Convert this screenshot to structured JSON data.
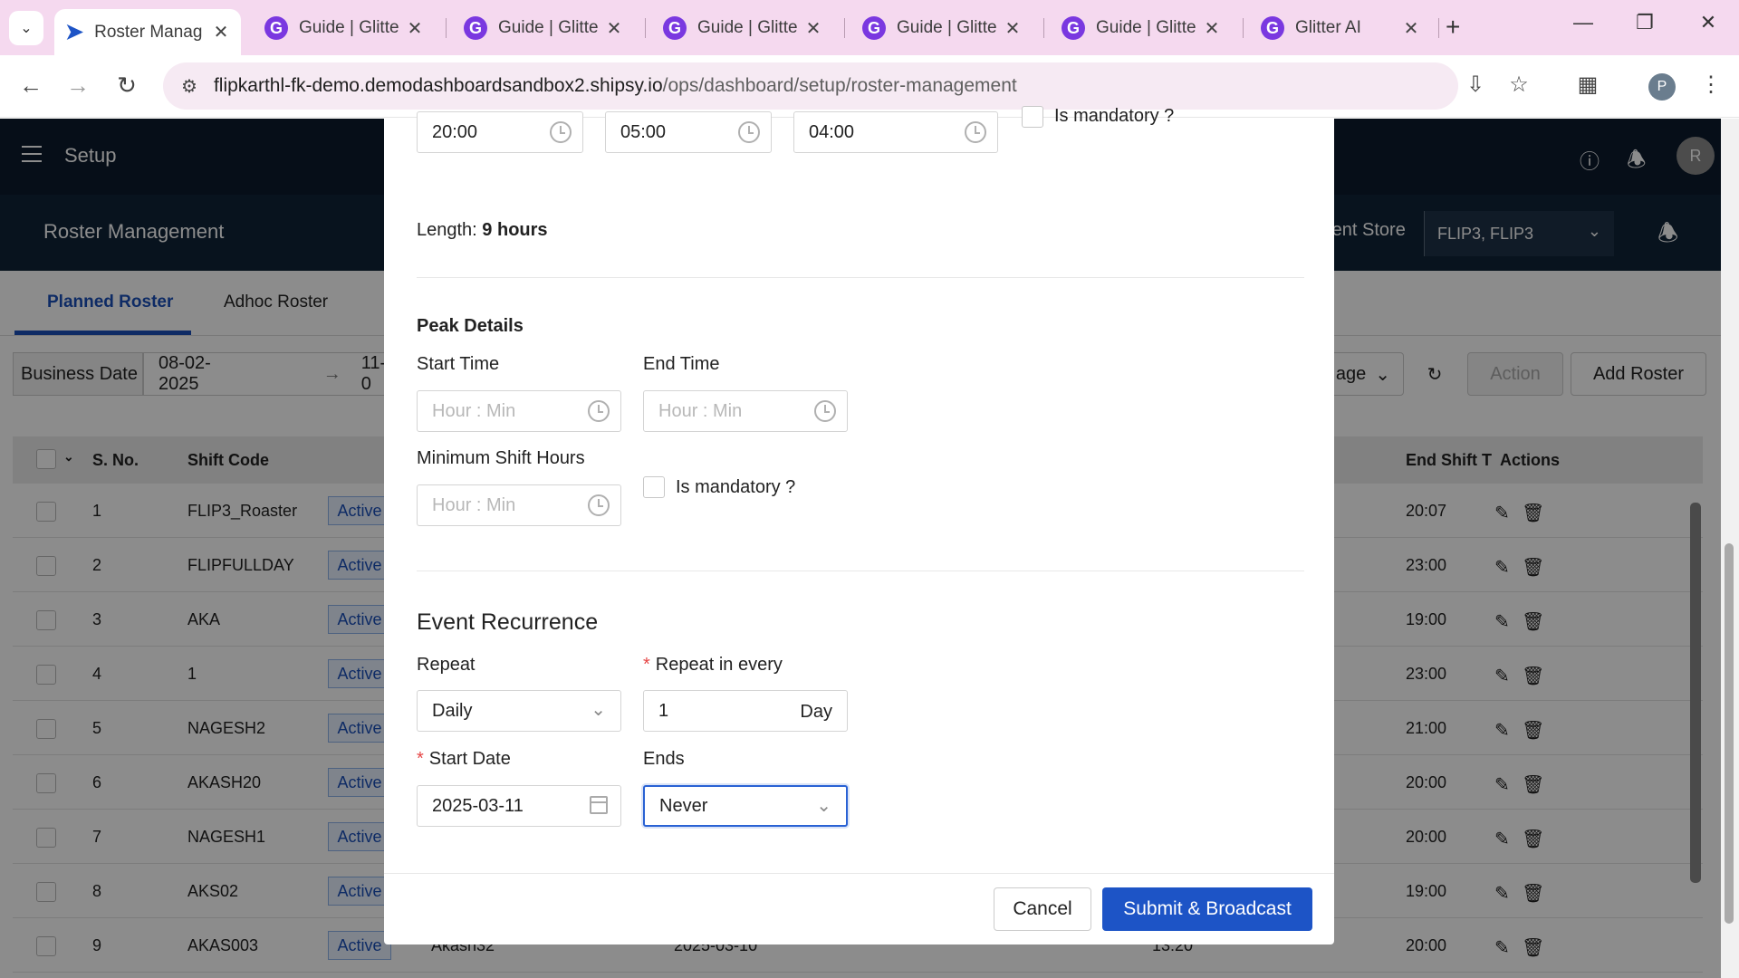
{
  "browser": {
    "tabs": [
      {
        "title": "Roster Manag",
        "active": true,
        "icon": "shipsy-icon"
      },
      {
        "title": "Guide | Glitter",
        "icon": "glitter-icon"
      },
      {
        "title": "Guide | Glitter",
        "icon": "glitter-icon"
      },
      {
        "title": "Guide | Glitter",
        "icon": "glitter-icon"
      },
      {
        "title": "Guide | Glitter",
        "icon": "glitter-icon"
      },
      {
        "title": "Guide | Glitter",
        "icon": "glitter-icon"
      },
      {
        "title": "Glitter AI",
        "icon": "glitter-icon"
      }
    ],
    "url_host": "flipkarthl-fk-demo.demodashboardsandbox2.shipsy.io",
    "url_path": "/ops/dashboard/setup/roster-management",
    "profile_initial": "P",
    "colors": {
      "tabbar": "#f5d9ef",
      "accent": "#1d54c6"
    }
  },
  "app": {
    "header_title": "Setup",
    "avatar_initial": "R",
    "sub_title": "Roster Management",
    "store_label": "rent Store",
    "store_value": "FLIP3, FLIP3",
    "tabs": [
      "Planned Roster",
      "Adhoc Roster"
    ],
    "filter": {
      "business_date_label": "Business Date",
      "start_date": "08-02-2025",
      "end_date_partial": "11-0",
      "page_partial": "age",
      "action_label": "Action",
      "add_roster_label": "Add Roster"
    },
    "table": {
      "headers": {
        "sno": "S. No.",
        "shift_code": "Shift Code",
        "end_shift": "End Shift T",
        "actions": "Actions"
      },
      "rows": [
        {
          "sno": "1",
          "code": "FLIP3_Roaster",
          "status": "Active",
          "end": "20:07"
        },
        {
          "sno": "2",
          "code": "FLIPFULLDAY",
          "status": "Active",
          "end": "23:00"
        },
        {
          "sno": "3",
          "code": "AKA",
          "status": "Active",
          "end": "19:00"
        },
        {
          "sno": "4",
          "code": "1",
          "status": "Active",
          "end": "23:00"
        },
        {
          "sno": "5",
          "code": "NAGESH2",
          "status": "Active",
          "end": "21:00"
        },
        {
          "sno": "6",
          "code": "AKASH20",
          "status": "Active",
          "end": "20:00"
        },
        {
          "sno": "7",
          "code": "NAGESH1",
          "status": "Active",
          "end": "20:00"
        },
        {
          "sno": "8",
          "code": "AKS02",
          "status": "Active",
          "end": "19:00"
        },
        {
          "sno": "9",
          "code": "AKAS003",
          "status": "Active",
          "end": "20:00",
          "extra1": "Akash32",
          "extra2": "2025-03-10",
          "extra3": "13:20"
        }
      ]
    }
  },
  "modal": {
    "times": {
      "start": "20:00",
      "end": "05:00",
      "third": "04:00"
    },
    "top_mandatory_partial": "Is mandatory ?",
    "length_label": "Length:",
    "length_value": "9 hours",
    "peak": {
      "title": "Peak Details",
      "start_label": "Start Time",
      "end_label": "End Time",
      "placeholder": "Hour : Min",
      "min_shift_label": "Minimum Shift Hours",
      "mandatory_label": "Is mandatory ?"
    },
    "recurrence": {
      "title": "Event Recurrence",
      "repeat_label": "Repeat",
      "repeat_value": "Daily",
      "repeat_every_label": "Repeat in every",
      "repeat_every_value": "1",
      "repeat_every_unit": "Day",
      "start_date_label": "Start Date",
      "start_date_value": "2025-03-11",
      "ends_label": "Ends",
      "ends_value": "Never"
    },
    "buttons": {
      "cancel": "Cancel",
      "submit": "Submit & Broadcast"
    }
  }
}
